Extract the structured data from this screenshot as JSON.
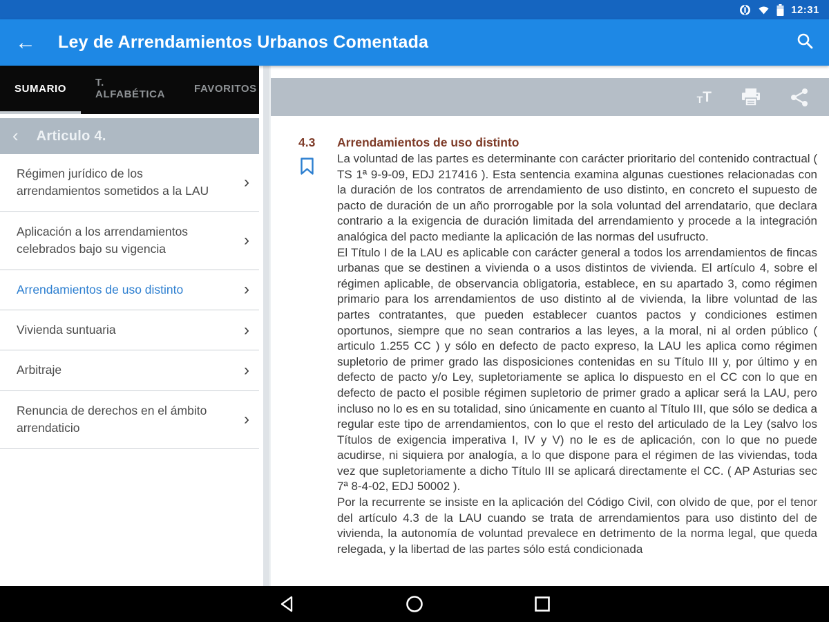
{
  "colors": {
    "status_bar_bg": "#1565c0",
    "app_bar_bg": "#1e88e5",
    "tab_bar_bg": "#0a0a0a",
    "section_header_bg": "#aeb9c3",
    "content_toolbar_bg": "#b5bec7",
    "accent_blue": "#2d7fd0",
    "heading_color": "#7e3b28"
  },
  "icons": {
    "back_arrow": "←",
    "chevron_left": "‹",
    "chevron_right": "›",
    "t_small": "T",
    "t_large": "T"
  },
  "status_bar": {
    "time": "12:31"
  },
  "app_bar": {
    "title": "Ley de Arrendamientos Urbanos Comentada"
  },
  "sidebar": {
    "tabs": [
      {
        "label": "SUMARIO",
        "active": true
      },
      {
        "label": "T. ALFABÉTICA",
        "active": false
      },
      {
        "label": "FAVORITOS",
        "active": false
      }
    ],
    "section_header": {
      "label": "Articulo 4."
    },
    "items": [
      {
        "label": "Régimen jurídico de los arrendamientos sometidos a la LAU",
        "selected": false
      },
      {
        "label": "Aplicación a los arrendamientos celebrados bajo su vigencia",
        "selected": false
      },
      {
        "label": "Arrendamientos de uso distinto",
        "selected": true
      },
      {
        "label": "Vivienda suntuaria",
        "selected": false
      },
      {
        "label": "Arbitraje",
        "selected": false
      },
      {
        "label": "Renuncia de derechos en el ámbito arrendaticio",
        "selected": false
      }
    ]
  },
  "content": {
    "section_number": "4.3",
    "section_title": "Arrendamientos de uso distinto",
    "paragraphs": [
      "La voluntad de las partes es determinante con carácter prioritario del contenido contractual ( TS 1ª 9-9-09, EDJ 217416 ). Esta sentencia examina algunas cuestiones relacionadas con la duración de los contratos de arrendamiento de uso distinto, en concreto el supuesto de pacto de duración de un año prorrogable por la sola voluntad del arrendatario, que declara contrario a la exigencia de duración limitada del arrendamiento y procede a la integración analógica del pacto mediante la aplicación de las normas del usufructo.",
      "El Título I de la LAU es aplicable con carácter general a todos los arrendamientos de fincas urbanas que se destinen a vivienda o a usos distintos de vivienda. El artículo 4, sobre el régimen aplicable, de observancia obligatoria, establece, en su apartado 3, como régimen primario para los arrendamientos de uso distinto al de vivienda, la libre voluntad de las partes contratantes, que pueden establecer cuantos pactos y condiciones estimen oportunos, siempre que no sean contrarios a las leyes, a la moral, ni al orden público ( articulo 1.255 CC ) y sólo en defecto de pacto expreso, la LAU les aplica como régimen supletorio de primer grado las disposiciones contenidas en su Título III y, por último y en defecto de pacto y/o Ley, supletoriamente se aplica lo dispuesto en el CC con lo que en defecto de pacto el posible régimen supletorio de primer grado a aplicar será la LAU, pero incluso no lo es en su totalidad, sino únicamente en cuanto al Título III, que sólo se dedica a regular este tipo de arrendamientos, con lo que el resto del articulado de la Ley (salvo los Títulos de exigencia imperativa I, IV y V) no le es de aplicación, con lo que no puede acudirse, ni siquiera por analogía, a lo que dispone para el régimen de las viviendas, toda vez que supletoriamente a dicho Título III se aplicará directamente el CC. ( AP Asturias sec 7ª 8-4-02, EDJ 50002 ).",
      "Por la recurrente se insiste en la aplicación del Código Civil, con olvido de que, por el tenor del artículo 4.3 de la LAU cuando se trata de arrendamientos para uso distinto del de vivienda, la autonomía de voluntad prevalece en detrimento de la norma legal, que queda relegada, y la libertad de las partes sólo está condicionada"
    ]
  }
}
